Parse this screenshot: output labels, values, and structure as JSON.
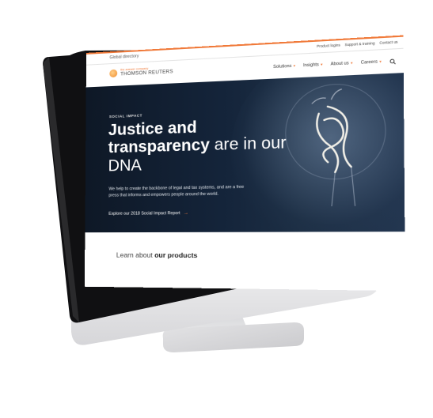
{
  "util": {
    "global_directory": "Global directory",
    "links": [
      "Product logins",
      "Support & training",
      "Contact us"
    ]
  },
  "logo": {
    "tagline": "the answer company",
    "name": "THOMSON REUTERS"
  },
  "nav": {
    "items": [
      "Solutions",
      "Insights",
      "About us",
      "Careers"
    ]
  },
  "hero": {
    "eyebrow": "SOCIAL IMPACT",
    "headline_bold_1": "Justice and",
    "headline_bold_2": "transparency",
    "headline_light_1": " are in our",
    "headline_light_2": "DNA",
    "copy": "We help to create the backbone of legal and tax systems, and are a free press that informs and empowers people around the world.",
    "cta": "Explore our 2018 Social Impact Report"
  },
  "below": {
    "learn_prefix": "Learn about ",
    "learn_bold": "our products"
  },
  "colors": {
    "accent": "#f07a3a",
    "hero_bg": "#14243a",
    "bezel": "#111111",
    "chin": "#e9e9eb"
  },
  "icons": {
    "search": "search-icon",
    "arrow": "arrow-right-icon",
    "chevron": "chevron-down-icon"
  }
}
